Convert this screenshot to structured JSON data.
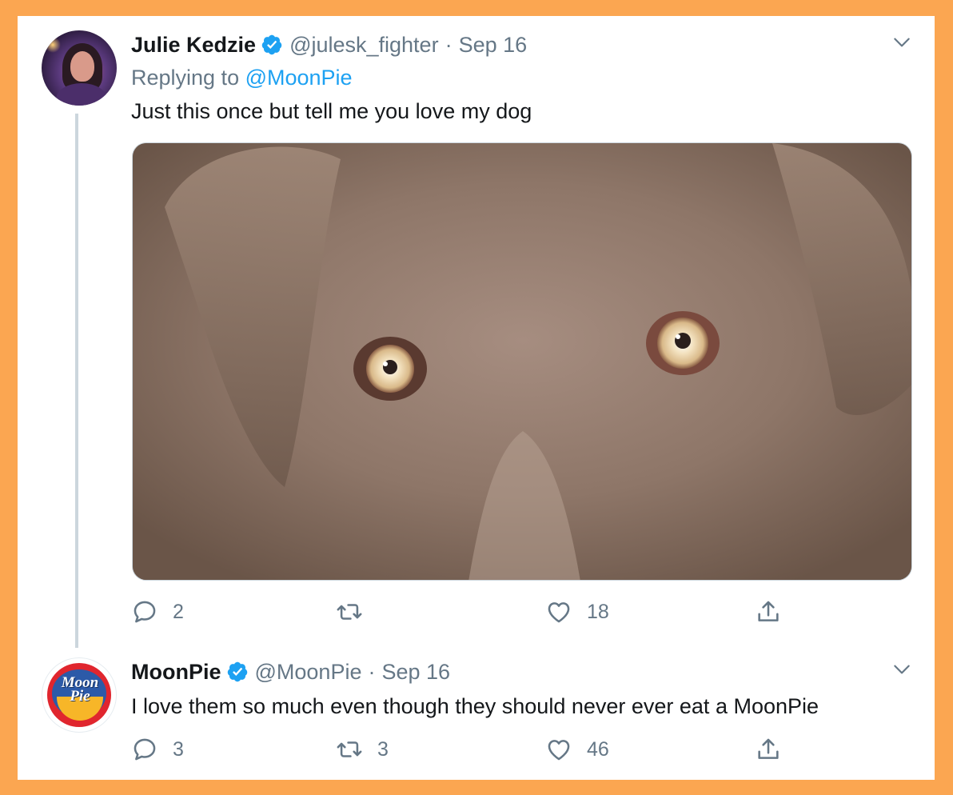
{
  "tweets": [
    {
      "author_name": "Julie Kedzie",
      "handle": "@julesk_fighter",
      "separator": "·",
      "date": "Sep 16",
      "replying_prefix": "Replying to ",
      "replying_to": "@MoonPie",
      "text": "Just this once but tell me you love my dog",
      "media_description": "close-up photo of a silver labrador's face",
      "counts": {
        "replies": "2",
        "retweets": "",
        "likes": "18"
      }
    },
    {
      "author_name": "MoonPie",
      "handle": "@MoonPie",
      "separator": "·",
      "date": "Sep 16",
      "text": "I love them so much even though they should never ever eat a MoonPie",
      "avatar_logo_text": [
        "Moon",
        "Pie"
      ],
      "counts": {
        "replies": "3",
        "retweets": "3",
        "likes": "46"
      }
    }
  ],
  "colors": {
    "frame": "#FBA651",
    "link": "#1DA1F2",
    "secondary_text": "#657786",
    "primary_text": "#14171A"
  },
  "icons": [
    "verified-badge-icon",
    "chevron-down-icon",
    "reply-icon",
    "retweet-icon",
    "like-icon",
    "share-icon"
  ]
}
